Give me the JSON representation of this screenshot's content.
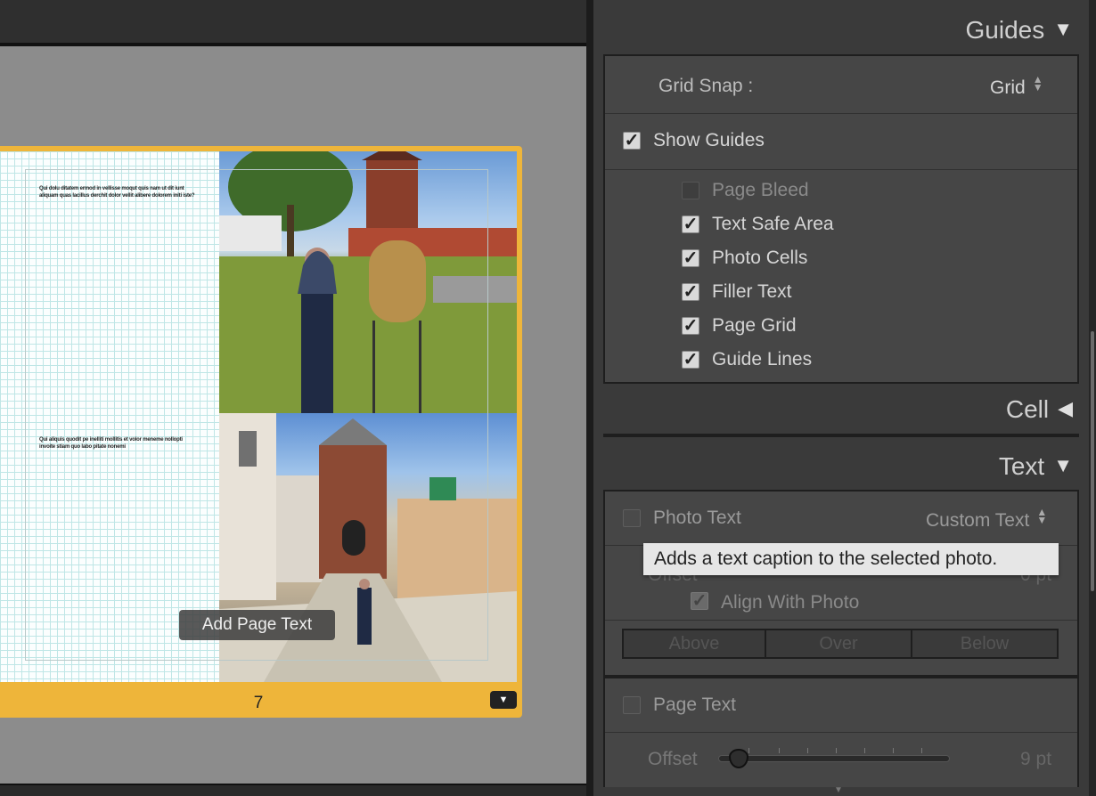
{
  "page": {
    "filler_text_1": "Qui dolu ditatem ermod in vellisse moqut quis nam ut dit iunt aliquam quas lacillus derchit dolor vellit alibere dolorem initi iste?",
    "filler_text_2": "Qui aliquis quodit pe inelliti mollitis et volor meneme nollopti invoite stiam quo labo pitate nonemi",
    "add_text_label": "Add Page Text",
    "page_number": "7",
    "menu_glyph": "▼"
  },
  "guides": {
    "header": "Guides",
    "header_glyph": "▼",
    "grid_snap_label": "Grid Snap :",
    "grid_snap_value": "Grid",
    "show_guides_label": "Show Guides",
    "items": [
      {
        "label": "Page Bleed",
        "checked": false
      },
      {
        "label": "Text Safe Area",
        "checked": true
      },
      {
        "label": "Photo Cells",
        "checked": true
      },
      {
        "label": "Filler Text",
        "checked": true
      },
      {
        "label": "Page Grid",
        "checked": true
      },
      {
        "label": "Guide Lines",
        "checked": true
      }
    ]
  },
  "cell": {
    "header": "Cell",
    "header_glyph": "◀"
  },
  "text": {
    "header": "Text",
    "header_glyph": "▼",
    "photo_text_label": "Photo Text",
    "photo_text_value": "Custom Text",
    "tooltip": "Adds a text caption to the selected photo.",
    "offset_label": "Offset",
    "offset_value": "0 pt",
    "align_label": "Align With Photo",
    "segments": [
      "Above",
      "Over",
      "Below"
    ],
    "page_text_label": "Page Text",
    "page_offset_label": "Offset",
    "page_offset_value": "9 pt",
    "page_offset_fraction": 0.05
  },
  "check_glyph": "✓",
  "updown_glyph": "▲▼"
}
